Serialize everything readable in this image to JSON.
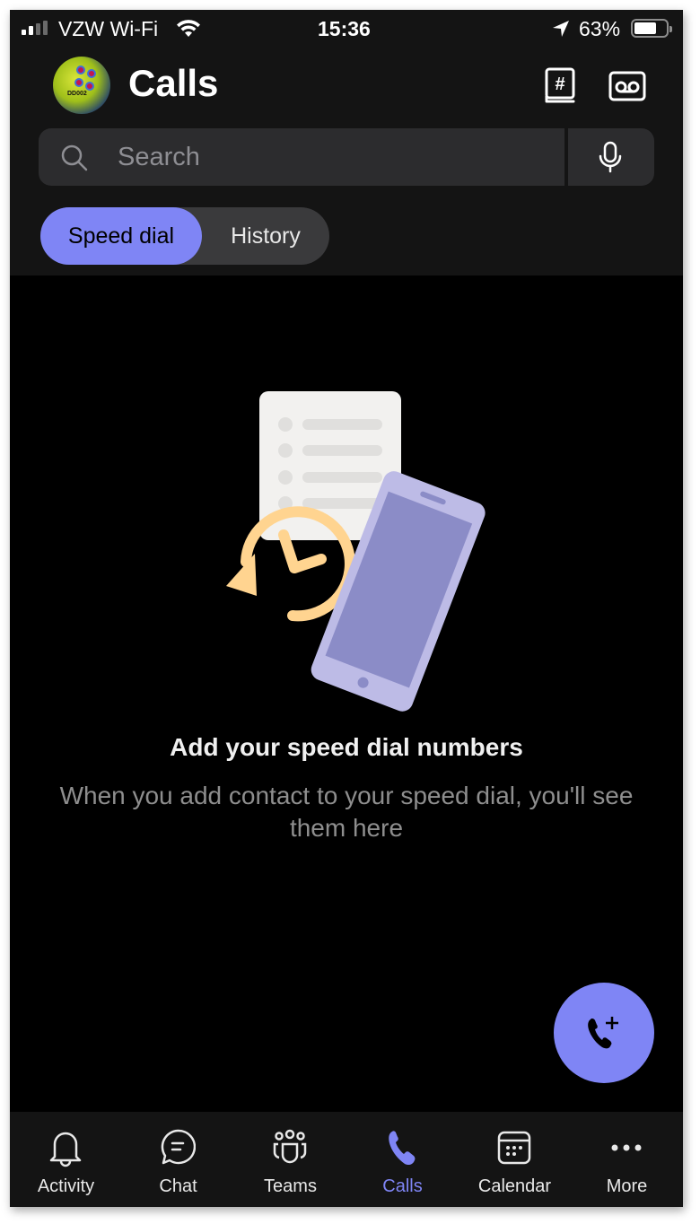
{
  "status_bar": {
    "carrier": "VZW Wi-Fi",
    "time": "15:36",
    "battery": "63%",
    "battery_level": 0.63,
    "signal_bars": 2,
    "icons": [
      "signal-icon",
      "wifi-icon",
      "location-arrow-icon",
      "battery-icon"
    ]
  },
  "header": {
    "title": "Calls",
    "avatar_tag": "DD002",
    "actions": [
      {
        "name": "dialpad-book-icon"
      },
      {
        "name": "voicemail-icon"
      }
    ]
  },
  "search": {
    "placeholder": "Search",
    "value": "",
    "icon": "search-icon",
    "mic_icon": "microphone-icon"
  },
  "segments": {
    "items": [
      {
        "label": "Speed dial",
        "active": true
      },
      {
        "label": "History",
        "active": false
      }
    ]
  },
  "empty_state": {
    "title": "Add your speed dial numbers",
    "subtitle": "When you add contact to your speed dial, you'll see them here",
    "illustration": "speed-dial-illustration"
  },
  "fab": {
    "icon": "add-call-icon"
  },
  "colors": {
    "accent": "#7f85f5",
    "header_bg": "#141414",
    "body_bg": "#000000",
    "search_bg": "#2c2c2e",
    "clock_icon": "#ffd490",
    "phone_frame": "#bdbbe6",
    "phone_screen": "#8b8cc7",
    "document": "#f2f1ef"
  },
  "tabbar": {
    "items": [
      {
        "label": "Activity",
        "icon": "bell-icon",
        "active": false
      },
      {
        "label": "Chat",
        "icon": "chat-icon",
        "active": false
      },
      {
        "label": "Teams",
        "icon": "teams-icon",
        "active": false
      },
      {
        "label": "Calls",
        "icon": "phone-icon",
        "active": true
      },
      {
        "label": "Calendar",
        "icon": "calendar-icon",
        "active": false
      },
      {
        "label": "More",
        "icon": "more-icon",
        "active": false
      }
    ]
  }
}
